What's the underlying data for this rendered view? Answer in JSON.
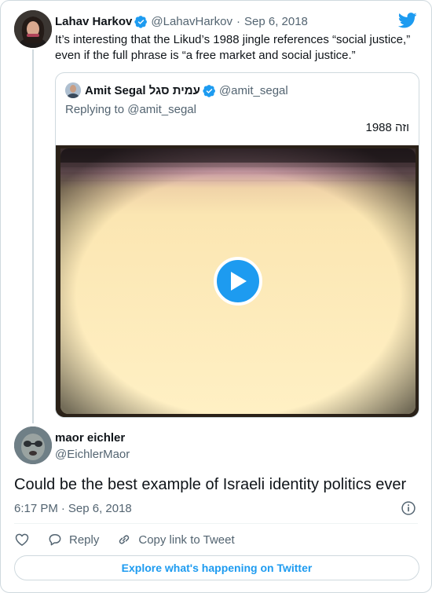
{
  "colors": {
    "accent": "#1d9bf0",
    "text": "#0f1419",
    "secondary": "#536471",
    "border": "#cfd9de"
  },
  "parent_tweet": {
    "display_name": "Lahav Harkov",
    "handle": "@LahavHarkov",
    "separator": "·",
    "date": "Sep 6, 2018",
    "verified_icon": "verified-badge-icon",
    "text": "It’s interesting that the Likud’s 1988 jingle references “social justice,” even if the full phrase is “a free market and social justice.”"
  },
  "quoted_tweet": {
    "display_name": "Amit Segal עמית סגל",
    "handle": "@amit_segal",
    "replying_prefix": "Replying to",
    "replying_to": "@amit_segal",
    "text": "וזה 1988",
    "media": {
      "type": "video",
      "play_icon": "play-icon"
    }
  },
  "reply_tweet": {
    "display_name": "maor eichler",
    "handle": "@EichlerMaor",
    "text": "Could be the best example of Israeli identity politics ever",
    "time": "6:17 PM",
    "separator": "·",
    "date": "Sep 6, 2018"
  },
  "actions": {
    "like_icon": "heart-icon",
    "reply_icon": "reply-bubble-icon",
    "reply_label": "Reply",
    "copy_icon": "link-icon",
    "copy_label": "Copy link to Tweet"
  },
  "footer": {
    "explore_label": "Explore what's happening on Twitter"
  },
  "branding": {
    "logo": "twitter-bird-icon"
  }
}
